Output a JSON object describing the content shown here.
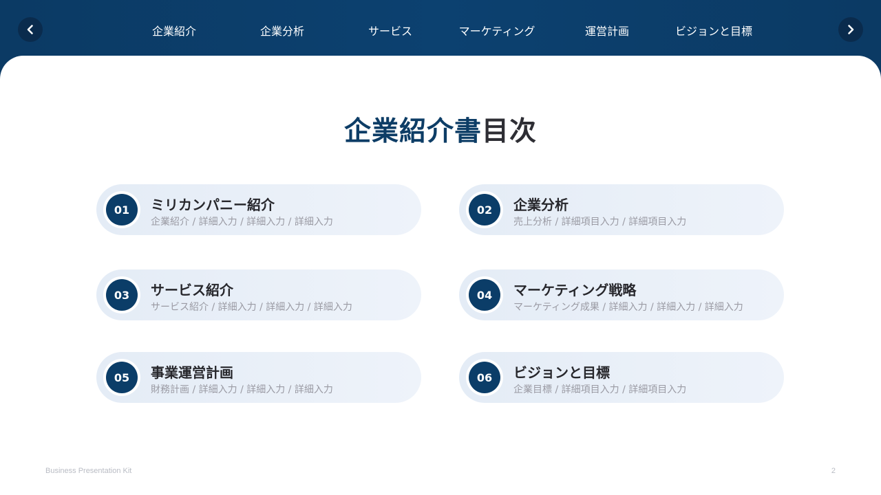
{
  "nav": {
    "prev_icon": "chevron-left-icon",
    "next_icon": "chevron-right-icon",
    "tabs": [
      "企業紹介",
      "企業分析",
      "サービス",
      "マーケティング",
      "運営計画",
      "ビジョンと目標"
    ]
  },
  "title": {
    "part1": "企業紹介書",
    "part2": "目次"
  },
  "items": [
    {
      "num": "01",
      "title": "ミリカンパニー紹介",
      "sub": "企業紹介 / 詳細入力 / 詳細入力 / 詳細入力"
    },
    {
      "num": "02",
      "title": "企業分析",
      "sub": "売上分析 / 詳細項目入力 / 詳細項目入力"
    },
    {
      "num": "03",
      "title": "サービス紹介",
      "sub": "サービス紹介 / 詳細入力 / 詳細入力 / 詳細入力"
    },
    {
      "num": "04",
      "title": "マーケティング戦略",
      "sub": "マーケティング成果 / 詳細入力 / 詳細入力 / 詳細入力"
    },
    {
      "num": "05",
      "title": "事業運営計画",
      "sub": "財務計画 / 詳細入力 / 詳細入力 / 詳細入力"
    },
    {
      "num": "06",
      "title": "ビジョンと目標",
      "sub": "企業目標 / 詳細項目入力 / 詳細項目入力"
    }
  ],
  "footer": {
    "brand": "Business Presentation Kit",
    "page": "2"
  },
  "colors": {
    "navy": "#0b3d68",
    "title_dark": "#2e2e34",
    "card_bg": "#e8eff8"
  }
}
